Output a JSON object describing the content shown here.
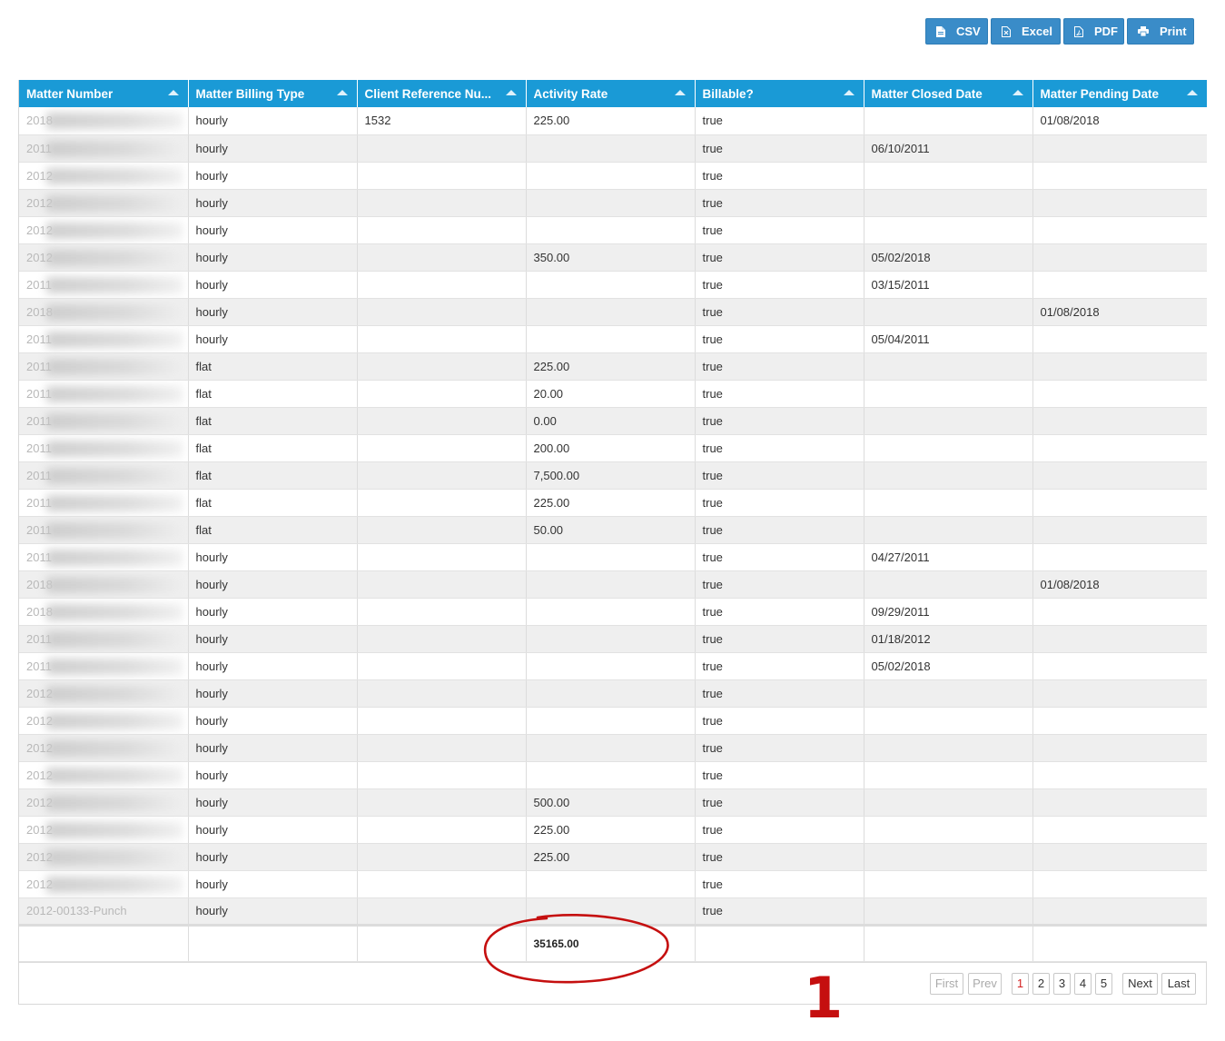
{
  "toolbar": {
    "buttons": [
      {
        "label": "CSV",
        "icon": "file-icon"
      },
      {
        "label": "Excel",
        "icon": "excel-icon"
      },
      {
        "label": "PDF",
        "icon": "pdf-icon"
      },
      {
        "label": "Print",
        "icon": "print-icon"
      }
    ]
  },
  "grid": {
    "columns": [
      "Matter Number",
      "Matter Billing Type",
      "Client Reference Nu...",
      "Activity Rate",
      "Billable?",
      "Matter Closed Date",
      "Matter Pending Date"
    ],
    "rows": [
      [
        "2018",
        "hourly",
        "1532",
        "225.00",
        "true",
        "",
        "01/08/2018"
      ],
      [
        "2011",
        "hourly",
        "",
        "",
        "true",
        "06/10/2011",
        ""
      ],
      [
        "2012",
        "hourly",
        "",
        "",
        "true",
        "",
        ""
      ],
      [
        "2012",
        "hourly",
        "",
        "",
        "true",
        "",
        ""
      ],
      [
        "2012",
        "hourly",
        "",
        "",
        "true",
        "",
        ""
      ],
      [
        "2012",
        "hourly",
        "",
        "350.00",
        "true",
        "05/02/2018",
        ""
      ],
      [
        "2011",
        "hourly",
        "",
        "",
        "true",
        "03/15/2011",
        ""
      ],
      [
        "2018",
        "hourly",
        "",
        "",
        "true",
        "",
        "01/08/2018"
      ],
      [
        "2011",
        "hourly",
        "",
        "",
        "true",
        "05/04/2011",
        ""
      ],
      [
        "2011",
        "flat",
        "",
        "225.00",
        "true",
        "",
        ""
      ],
      [
        "2011",
        "flat",
        "",
        "20.00",
        "true",
        "",
        ""
      ],
      [
        "2011",
        "flat",
        "",
        "0.00",
        "true",
        "",
        ""
      ],
      [
        "2011",
        "flat",
        "",
        "200.00",
        "true",
        "",
        ""
      ],
      [
        "2011",
        "flat",
        "",
        "7,500.00",
        "true",
        "",
        ""
      ],
      [
        "2011",
        "flat",
        "",
        "225.00",
        "true",
        "",
        ""
      ],
      [
        "2011",
        "flat",
        "",
        "50.00",
        "true",
        "",
        ""
      ],
      [
        "2011",
        "hourly",
        "",
        "",
        "true",
        "04/27/2011",
        ""
      ],
      [
        "2018",
        "hourly",
        "",
        "",
        "true",
        "",
        "01/08/2018"
      ],
      [
        "2018",
        "hourly",
        "",
        "",
        "true",
        "09/29/2011",
        ""
      ],
      [
        "2011",
        "hourly",
        "",
        "",
        "true",
        "01/18/2012",
        ""
      ],
      [
        "2011",
        "hourly",
        "",
        "",
        "true",
        "05/02/2018",
        ""
      ],
      [
        "2012",
        "hourly",
        "",
        "",
        "true",
        "",
        ""
      ],
      [
        "2012",
        "hourly",
        "",
        "",
        "true",
        "",
        ""
      ],
      [
        "2012",
        "hourly",
        "",
        "",
        "true",
        "",
        ""
      ],
      [
        "2012",
        "hourly",
        "",
        "",
        "true",
        "",
        ""
      ],
      [
        "2012",
        "hourly",
        "",
        "500.00",
        "true",
        "",
        ""
      ],
      [
        "2012",
        "hourly",
        "",
        "225.00",
        "true",
        "",
        ""
      ],
      [
        "2012",
        "hourly",
        "",
        "225.00",
        "true",
        "",
        ""
      ],
      [
        "2012",
        "hourly",
        "",
        "",
        "true",
        "",
        ""
      ],
      [
        "2012-00133-Punch",
        "hourly",
        "",
        "",
        "true",
        "",
        ""
      ]
    ],
    "total_activity_rate": "35165.00"
  },
  "pager": {
    "first": "First",
    "prev": "Prev",
    "pages": [
      "1",
      "2",
      "3",
      "4",
      "5"
    ],
    "current_page": "1",
    "next": "Next",
    "last": "Last"
  },
  "annotation": {
    "number": "1",
    "color": "#c50f0f"
  },
  "colors": {
    "header": "#1a9ad6",
    "button": "#3a8cc8",
    "row_alt": "#efefef"
  }
}
